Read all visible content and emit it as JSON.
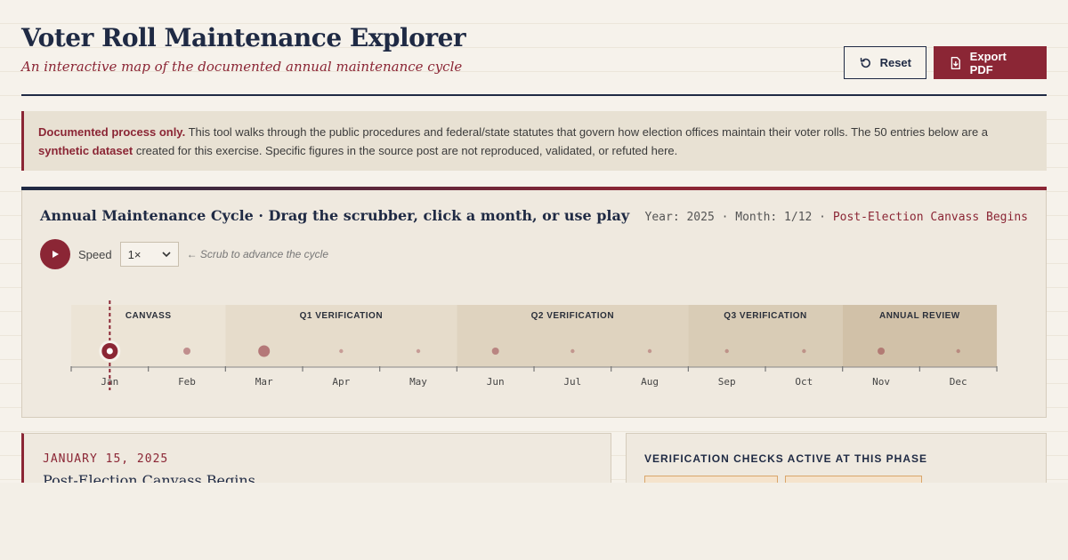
{
  "header": {
    "title": "Voter Roll Maintenance Explorer",
    "subtitle": "An interactive map of the documented annual maintenance cycle",
    "reset_label": "Reset",
    "export_label": "Export PDF"
  },
  "notice": {
    "lead": "Documented process only.",
    "text1": " This tool walks through the public procedures and federal/state statutes that govern how election offices maintain their voter rolls. The 50 entries below are a ",
    "emph": "synthetic dataset",
    "text2": " created for this exercise. Specific figures in the source post are not reproduced, validated, or refuted here."
  },
  "panel": {
    "title": "Annual Maintenance Cycle · Drag the scrubber, click a month, or use play",
    "year_text": "Year: 2025 · Month: 1/12 · ",
    "phase_name": "Post-Election Canvass Begins",
    "speed_label": "Speed",
    "speed_value": "1×",
    "hint": "← Scrub to advance the cycle"
  },
  "timeline": {
    "current_month_index": 0,
    "months": [
      "Jan",
      "Feb",
      "Mar",
      "Apr",
      "May",
      "Jun",
      "Jul",
      "Aug",
      "Sep",
      "Oct",
      "Nov",
      "Dec"
    ],
    "phases": [
      {
        "label": "CANVASS",
        "start": 0,
        "end": 2,
        "color": "#ece4d6"
      },
      {
        "label": "Q1 VERIFICATION",
        "start": 2,
        "end": 5,
        "color": "#e6dccb"
      },
      {
        "label": "Q2 VERIFICATION",
        "start": 5,
        "end": 8,
        "color": "#dfd3bf"
      },
      {
        "label": "Q3 VERIFICATION",
        "start": 8,
        "end": 10,
        "color": "#d9ccb6"
      },
      {
        "label": "ANNUAL REVIEW",
        "start": 10,
        "end": 12,
        "color": "#d1c1a8"
      }
    ],
    "activity": [
      3,
      2,
      3,
      1,
      1,
      2,
      1,
      1,
      1,
      1,
      2,
      1
    ]
  },
  "event": {
    "date": "JANUARY 15, 2025",
    "title": "Post-Election Canvass Begins"
  },
  "checks": {
    "title": "VERIFICATION CHECKS ACTIVE AT THIS PHASE"
  },
  "colors": {
    "accent": "#8b2635",
    "navy": "#1f2a44"
  }
}
